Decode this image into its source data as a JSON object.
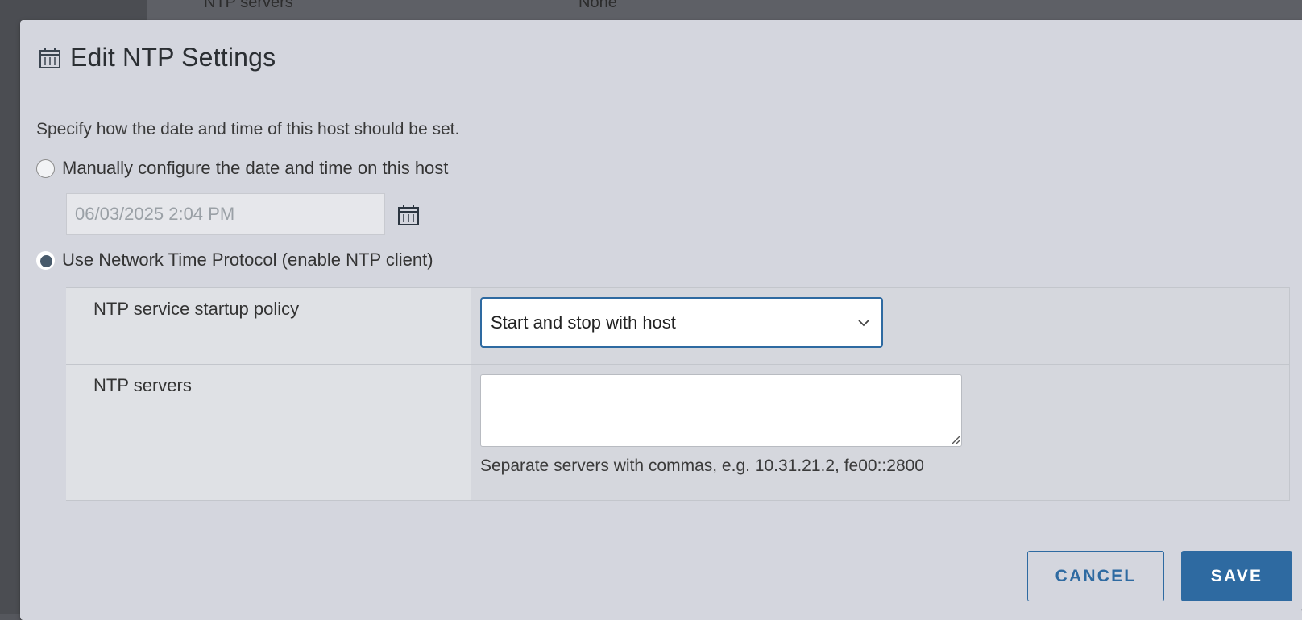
{
  "background": {
    "row_label": "NTP servers",
    "row_value": "None"
  },
  "dialog": {
    "title": "Edit NTP Settings",
    "title_icon": "calendar-icon",
    "description": "Specify how the date and time of this host should be set.",
    "option_manual": {
      "label": "Manually configure the date and time on this host",
      "selected": false,
      "datetime_value": "06/03/2025 2:04 PM"
    },
    "option_ntp": {
      "label": "Use Network Time Protocol (enable NTP client)",
      "selected": true
    },
    "startup_policy": {
      "label": "NTP service startup policy",
      "value": "Start and stop with host"
    },
    "ntp_servers": {
      "label": "NTP servers",
      "value": "",
      "hint": "Separate servers with commas, e.g. 10.31.21.2, fe00::2800"
    },
    "buttons": {
      "cancel": "CANCEL",
      "save": "SAVE"
    }
  },
  "colors": {
    "accent": "#2e6aa1",
    "dialog_bg": "#d4d6de",
    "backdrop": "#55575d"
  }
}
